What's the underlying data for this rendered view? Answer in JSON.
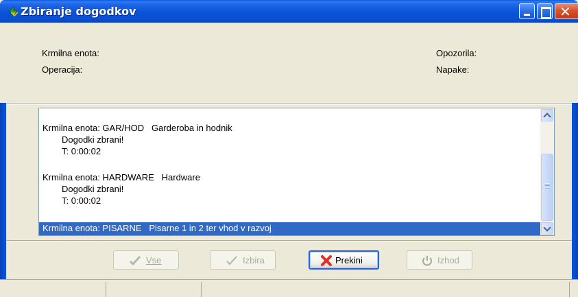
{
  "window": {
    "title": "Zbiranje dogodkov"
  },
  "header": {
    "unit_label": "Krmilna enota:",
    "operation_label": "Operacija:",
    "warnings_label": "Opozorila:",
    "errors_label": "Napake:"
  },
  "log": {
    "entries": [
      {
        "line": "Krmilna enota: GAR/HOD   Garderoba in hodnik"
      },
      {
        "line": "Dogodki zbrani!"
      },
      {
        "line": "T: 0:00:02"
      },
      {
        "line": "Krmilna enota: HARDWARE   Hardware"
      },
      {
        "line": "Dogodki zbrani!"
      },
      {
        "line": "T: 0:00:02"
      }
    ],
    "selected": "Krmilna enota: PISARNE   Pisarne 1 in 2 ter vhod v razvoj"
  },
  "buttons": {
    "all": "Vse",
    "selection": "Izbira",
    "stop": "Prekini",
    "exit": "Izhod"
  },
  "icons": {
    "title": "app-icon",
    "all": "check-icon",
    "selection": "check-icon",
    "stop": "x-icon",
    "exit": "power-icon"
  },
  "colors": {
    "titlebar": "#0a54d8",
    "selection": "#316ac5",
    "stop_icon": "#e03024"
  }
}
